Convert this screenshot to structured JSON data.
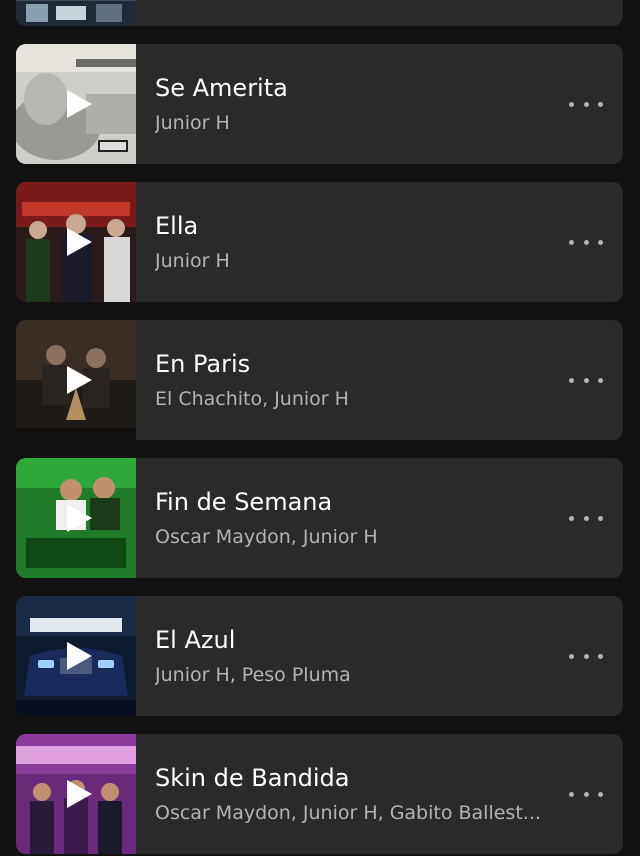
{
  "tracks": [
    {
      "title": "",
      "artists": ""
    },
    {
      "title": "Se Amerita",
      "artists": "Junior H"
    },
    {
      "title": "Ella",
      "artists": "Junior H"
    },
    {
      "title": "En Paris",
      "artists": "El Chachito, Junior H"
    },
    {
      "title": "Fin de Semana",
      "artists": "Oscar Maydon, Junior H"
    },
    {
      "title": "El Azul",
      "artists": "Junior H, Peso Pluma"
    },
    {
      "title": "Skin de Bandida",
      "artists": "Oscar Maydon, Junior H, Gabito Ballest..."
    }
  ],
  "icons": {
    "play": "play-icon",
    "more": "more-options-icon"
  },
  "colors": {
    "background": "#121212",
    "card": "#2a2a2a",
    "title": "#ffffff",
    "subtitle": "#b3b3b3"
  }
}
